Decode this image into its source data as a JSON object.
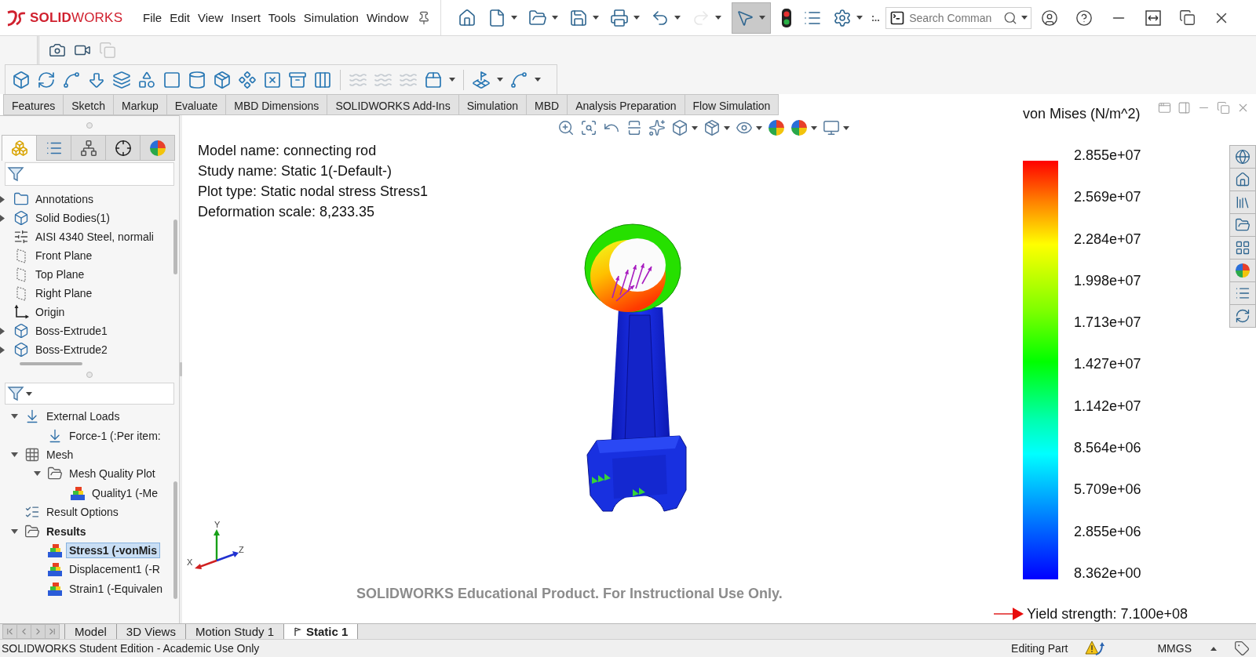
{
  "title_bar": {
    "logo": "**SOLID**WORKS",
    "menu": [
      "File",
      "Edit",
      "View",
      "Insert",
      "Tools",
      "Simulation",
      "Window"
    ],
    "tools": [
      {
        "disabled": false,
        "pressed": false
      },
      {
        "disabled": false,
        "pressed": false
      },
      {
        "disabled": false,
        "pressed": false
      },
      {
        "disabled": false,
        "pressed": false
      },
      {
        "disabled": false,
        "pressed": false
      },
      {
        "disabled": false,
        "pressed": false
      },
      {
        "disabled": true,
        "pressed": false
      },
      {
        "disabled": false,
        "pressed": true
      },
      {
        "disabled": false,
        "pressed": false
      },
      {
        "disabled": false,
        "pressed": false
      },
      {
        "disabled": false,
        "pressed": false
      }
    ],
    "search": {
      "placeholder": "Search Comman"
    }
  },
  "capture_tools": [
    {
      "disabled": false
    },
    {
      "disabled": false
    },
    {
      "disabled": true
    }
  ],
  "feature_tools": [
    {
      "disabled": false
    },
    {
      "disabled": false
    },
    {
      "disabled": false
    },
    {
      "disabled": false
    },
    {
      "disabled": false
    },
    {
      "disabled": false
    },
    {
      "disabled": false
    },
    {
      "disabled": false
    },
    {
      "disabled": false
    },
    {
      "disabled": false
    },
    {
      "disabled": false
    },
    {
      "disabled": false
    },
    {
      "disabled": false
    },
    {
      "disabled": true
    },
    {
      "disabled": true
    },
    {
      "disabled": true
    },
    {
      "disabled": false
    },
    {
      "disabled": false
    },
    {
      "disabled": false
    }
  ],
  "command_tabs": [
    {
      "label": "Features",
      "selected": false
    },
    {
      "label": "Sketch",
      "selected": false
    },
    {
      "label": "Markup",
      "selected": false
    },
    {
      "label": "Evaluate",
      "selected": false
    },
    {
      "label": "MBD Dimensions",
      "selected": false
    },
    {
      "label": "SOLIDWORKS Add-Ins",
      "selected": false
    },
    {
      "label": "Simulation",
      "selected": false
    },
    {
      "label": "MBD",
      "selected": false
    },
    {
      "label": "Analysis Preparation",
      "selected": false
    },
    {
      "label": "Flow Simulation",
      "selected": false
    }
  ],
  "panel_tabs": [
    {
      "selected": true
    },
    {
      "selected": false
    },
    {
      "selected": false
    },
    {
      "selected": false
    },
    {
      "selected": false
    }
  ],
  "feature_tree": [
    {
      "kind": "annotations",
      "label": "Annotations",
      "expanded": false,
      "selected": false
    },
    {
      "kind": "bodies",
      "label": "Solid Bodies(1)",
      "expanded": false,
      "selected": false
    },
    {
      "kind": "material",
      "label": "AISI 4340 Steel, normali",
      "selected": false
    },
    {
      "kind": "plane",
      "label": "Front Plane",
      "selected": false
    },
    {
      "kind": "plane",
      "label": "Top Plane",
      "selected": false
    },
    {
      "kind": "plane",
      "label": "Right Plane",
      "selected": false
    },
    {
      "kind": "origin",
      "label": "Origin",
      "selected": false
    },
    {
      "kind": "feature",
      "label": "Boss-Extrude1",
      "expanded": false,
      "selected": false
    },
    {
      "kind": "feature",
      "label": "Boss-Extrude2",
      "expanded": false,
      "selected": false
    }
  ],
  "sim_tree": [
    {
      "kind": "loads",
      "label": "External Loads",
      "expanded": true,
      "selected": false,
      "active": false,
      "children": [
        {
          "kind": "force",
          "label": "Force-1 (:Per item:",
          "selected": false,
          "active": false
        }
      ]
    },
    {
      "kind": "mesh",
      "label": "Mesh",
      "expanded": true,
      "selected": false,
      "active": false,
      "children": [
        {
          "kind": "plot_folder",
          "label": "Mesh Quality Plot",
          "expanded": true,
          "selected": false,
          "active": false,
          "children": [
            {
              "kind": "plot",
              "label": "Quality1 (-Me",
              "selected": false,
              "active": false
            }
          ]
        }
      ]
    },
    {
      "kind": "options",
      "label": "Result Options",
      "selected": false,
      "active": false
    },
    {
      "kind": "plot_folder",
      "label": "Results",
      "expanded": true,
      "selected": false,
      "active": true,
      "children": [
        {
          "kind": "plot",
          "label": "Stress1 (-vonMis",
          "selected": true,
          "active": true
        },
        {
          "kind": "plot",
          "label": "Displacement1 (-R",
          "selected": false,
          "active": false
        },
        {
          "kind": "plot",
          "label": "Strain1 (-Equivalen",
          "selected": false,
          "active": false
        }
      ]
    }
  ],
  "plot_info": [
    "Model name: connecting rod",
    "Study name: Static 1(-Default-)",
    "Plot type: Static nodal stress Stress1",
    "Deformation scale: 8,233.35"
  ],
  "triad": {
    "y": "Y",
    "x": "X",
    "z": "Z"
  },
  "educational_notice": "SOLIDWORKS Educational Product. For Instructional Use Only.",
  "legend": {
    "title": "von Mises (N/m^2)",
    "labels": [
      "2.855e+07",
      "2.569e+07",
      "2.284e+07",
      "1.998e+07",
      "1.713e+07",
      "1.427e+07",
      "1.142e+07",
      "8.564e+06",
      "5.709e+06",
      "2.855e+06",
      "8.362e+00"
    ],
    "yield": "Yield strength: 7.100e+08"
  },
  "study_tabs": [
    {
      "kind": "model",
      "label": "Model",
      "selected": false
    },
    {
      "kind": "views",
      "label": "3D Views",
      "selected": false
    },
    {
      "kind": "motion",
      "label": "Motion Study 1",
      "selected": false
    },
    {
      "kind": "simulation",
      "label": "Static 1",
      "selected": true
    }
  ],
  "status_bar": {
    "edition": "SOLIDWORKS Student Edition - Academic Use Only",
    "mode": "Editing Part",
    "units": "MMGS"
  }
}
